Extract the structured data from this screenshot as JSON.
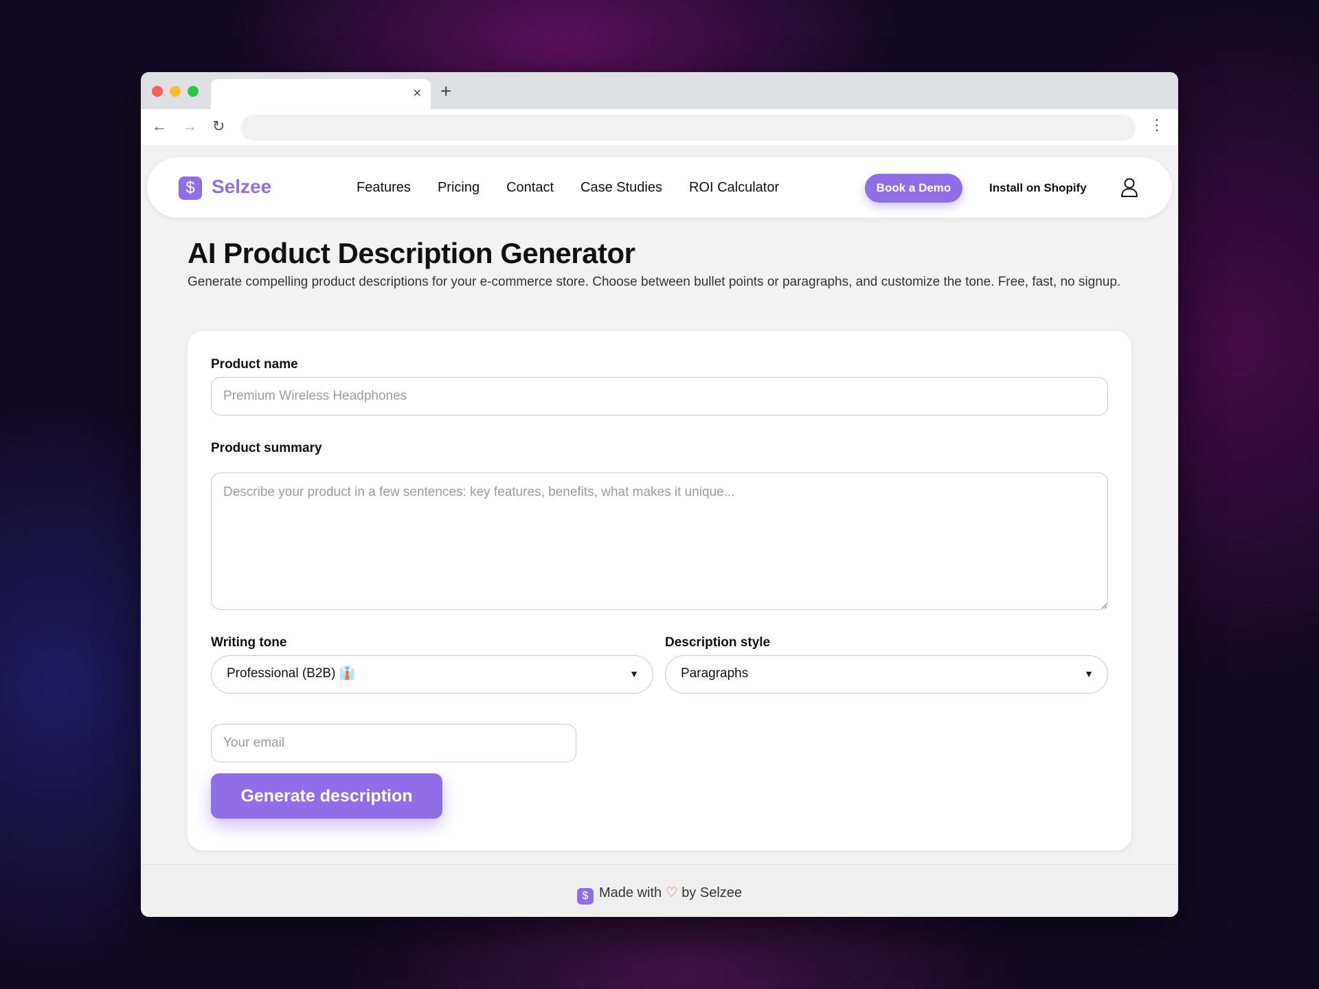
{
  "browser": {
    "tab_close": "×",
    "new_tab": "+",
    "back": "←",
    "forward": "→",
    "reload": "↻",
    "menu": "⋮"
  },
  "navbar": {
    "logo_glyph": "$",
    "brand": "Selzee",
    "links": [
      "Features",
      "Pricing",
      "Contact",
      "Case Studies",
      "ROI Calculator"
    ],
    "book_demo": "Book a Demo",
    "install": "Install on Shopify"
  },
  "main": {
    "title": "AI Product Description Generator",
    "subtitle": "Generate compelling product descriptions for your e-commerce store. Choose between bullet points or paragraphs, and customize the tone. Free, fast, no signup."
  },
  "form": {
    "product_name_label": "Product name",
    "product_name_placeholder": "Premium Wireless Headphones",
    "product_summary_label": "Product summary",
    "product_summary_placeholder": "Describe your product in a few sentences: key features, benefits, what makes it unique...",
    "tone_label": "Writing tone",
    "tone_value": "Professional (B2B) 👔",
    "style_label": "Description style",
    "style_value": "Paragraphs",
    "email_placeholder": "Your email",
    "submit": "Generate description"
  },
  "footer": {
    "logo_glyph": "$",
    "made_with": "Made with",
    "heart": "♡",
    "by": "by Selzee"
  },
  "colors": {
    "accent": "#8f6ee8",
    "heart": "#f0506e"
  }
}
